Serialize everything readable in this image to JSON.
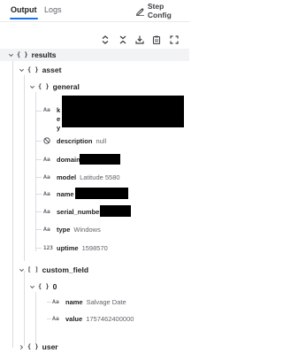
{
  "tabs": {
    "output": "Output",
    "logs": "Logs"
  },
  "step_config": "Step Config",
  "toolbar": {
    "expand": "expand-all",
    "collapse": "collapse-all",
    "download": "download",
    "copy": "copy",
    "fullscreen": "fullscreen"
  },
  "tree": {
    "results": "results",
    "asset": "asset",
    "general": "general",
    "key_k": "k",
    "key_e": "e",
    "key_y": "y",
    "description_key": "description",
    "description_val": "null",
    "domain_key": "domain",
    "model_key": "model",
    "model_val": "Latitude 5580",
    "name_key": "name",
    "serial_key": "serial_number",
    "type_key": "type",
    "type_val": "Windows",
    "uptime_key": "uptime",
    "uptime_val": "1598570",
    "custom_field": "custom_field",
    "index_0": "0",
    "cf_name_key": "name",
    "cf_name_val": "Salvage Date",
    "cf_value_key": "value",
    "cf_value_val": "1757462400000",
    "user": "user"
  },
  "icons": {
    "object": "{ }",
    "array": "[ ]",
    "string_type": "Aa",
    "number_type": "123",
    "null_type": "null-circle"
  },
  "colors": {
    "tab_underline": "#1a73e8",
    "selected_row": "#f1f3f4",
    "redaction": "#000000"
  }
}
